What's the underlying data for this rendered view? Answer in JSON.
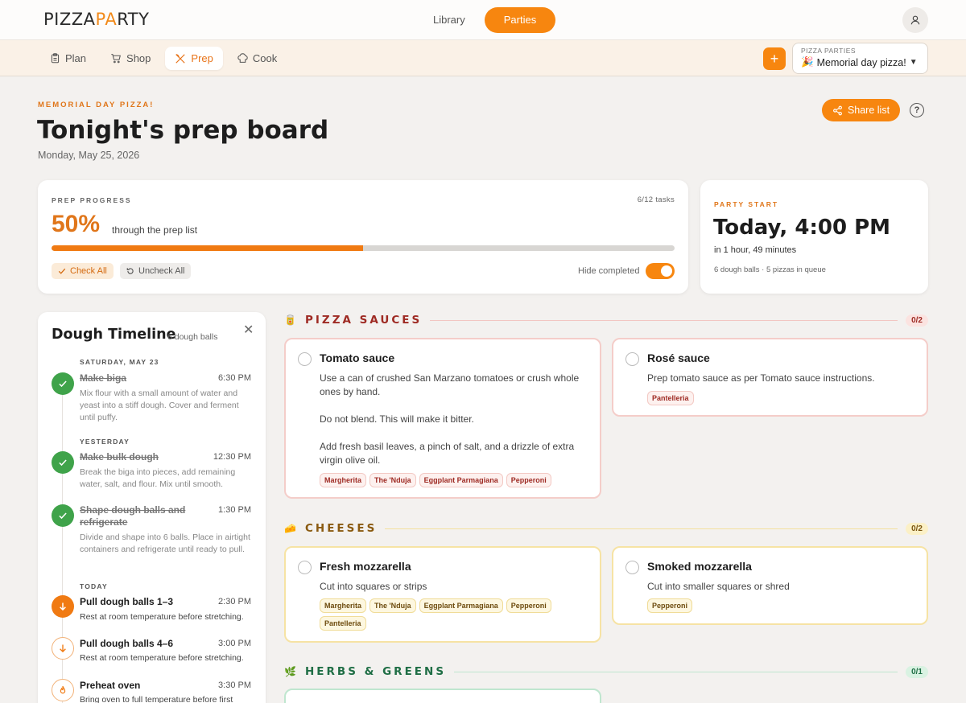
{
  "app": {
    "logo_left": "PIZZA",
    "logo_accent": "PA",
    "logo_right": "RTY",
    "nav": [
      {
        "label": "Library"
      },
      {
        "label": "Parties"
      }
    ]
  },
  "tabs": [
    {
      "label": "Plan",
      "icon": "clipboard-icon"
    },
    {
      "label": "Shop",
      "icon": "cart-icon"
    },
    {
      "label": "Prep",
      "icon": "utensils-icon"
    },
    {
      "label": "Cook",
      "icon": "chef-hat-icon"
    }
  ],
  "party_select": {
    "label": "PIZZA PARTIES",
    "value": "Memorial day pizza!",
    "emoji": "🎉"
  },
  "header": {
    "eyebrow": "MEMORIAL DAY PIZZA!",
    "title": "Tonight's prep board",
    "date": "Monday, May 25, 2026",
    "share_label": "Share list",
    "help": "?"
  },
  "progress": {
    "label": "PREP PROGRESS",
    "count": "6/12 tasks",
    "percent_text": "50%",
    "percent": 50,
    "sub": "through the prep list",
    "check_all": "Check All",
    "uncheck_all": "Uncheck All",
    "hide_completed": "Hide completed",
    "hide_completed_on": true
  },
  "party_start": {
    "label": "PARTY START",
    "time": "Today, 4:00 PM",
    "relative": "in 1 hour, 49 minutes",
    "meta": "6 dough balls · 5 pizzas in queue"
  },
  "timeline": {
    "title": "Dough Timeline",
    "subtitle": "6 dough balls",
    "days": [
      "SATURDAY, MAY 23",
      "YESTERDAY",
      "TODAY"
    ],
    "steps": [
      {
        "name": "Make biga",
        "time": "6:30 PM",
        "desc": "Mix flour with a small amount of water and yeast into a stiff dough. Cover and ferment until puffy.",
        "status": "done"
      },
      {
        "name": "Make bulk dough",
        "time": "12:30 PM",
        "desc": "Break the biga into pieces, add remaining water, salt, and flour. Mix until smooth.",
        "status": "done"
      },
      {
        "name": "Shape dough balls and refrigerate",
        "time": "1:30 PM",
        "desc": "Divide and shape into 6 balls. Place in airtight containers and refrigerate until ready to pull.",
        "status": "done"
      },
      {
        "name": "Pull dough balls 1–3",
        "time": "2:30 PM",
        "desc": "Rest at room temperature before stretching.",
        "status": "now"
      },
      {
        "name": "Pull dough balls 4–6",
        "time": "3:00 PM",
        "desc": "Rest at room temperature before stretching.",
        "status": "next"
      },
      {
        "name": "Preheat oven",
        "time": "3:30 PM",
        "desc": "Bring oven to full temperature before first",
        "status": "next"
      }
    ]
  },
  "sections": [
    {
      "title": "PIZZA SAUCES",
      "emoji": "🥫",
      "badge": "0/2",
      "tasks": [
        {
          "name": "Tomato sauce",
          "desc": [
            "Use a can of crushed San Marzano tomatoes or crush whole ones by hand.",
            "Do not blend. This will make it bitter.",
            "Add fresh basil leaves, a pinch of salt, and a drizzle of extra virgin olive oil."
          ],
          "tags": [
            "Margherita",
            "The 'Nduja",
            "Eggplant Parmagiana",
            "Pepperoni"
          ]
        },
        {
          "name": "Rosé sauce",
          "desc": [
            "Prep tomato sauce as per Tomato sauce instructions."
          ],
          "tags": [
            "Pantelleria"
          ]
        }
      ]
    },
    {
      "title": "CHEESES",
      "emoji": "🧀",
      "badge": "0/2",
      "tasks": [
        {
          "name": "Fresh mozzarella",
          "desc": [
            "Cut into squares or strips"
          ],
          "tags": [
            "Margherita",
            "The 'Nduja",
            "Eggplant Parmagiana",
            "Pepperoni",
            "Pantelleria"
          ]
        },
        {
          "name": "Smoked mozzarella",
          "desc": [
            "Cut into smaller squares or shred"
          ],
          "tags": [
            "Pepperoni"
          ]
        }
      ]
    },
    {
      "title": "HERBS & GREENS",
      "emoji": "🌿",
      "badge": "0/1",
      "tasks": []
    }
  ]
}
